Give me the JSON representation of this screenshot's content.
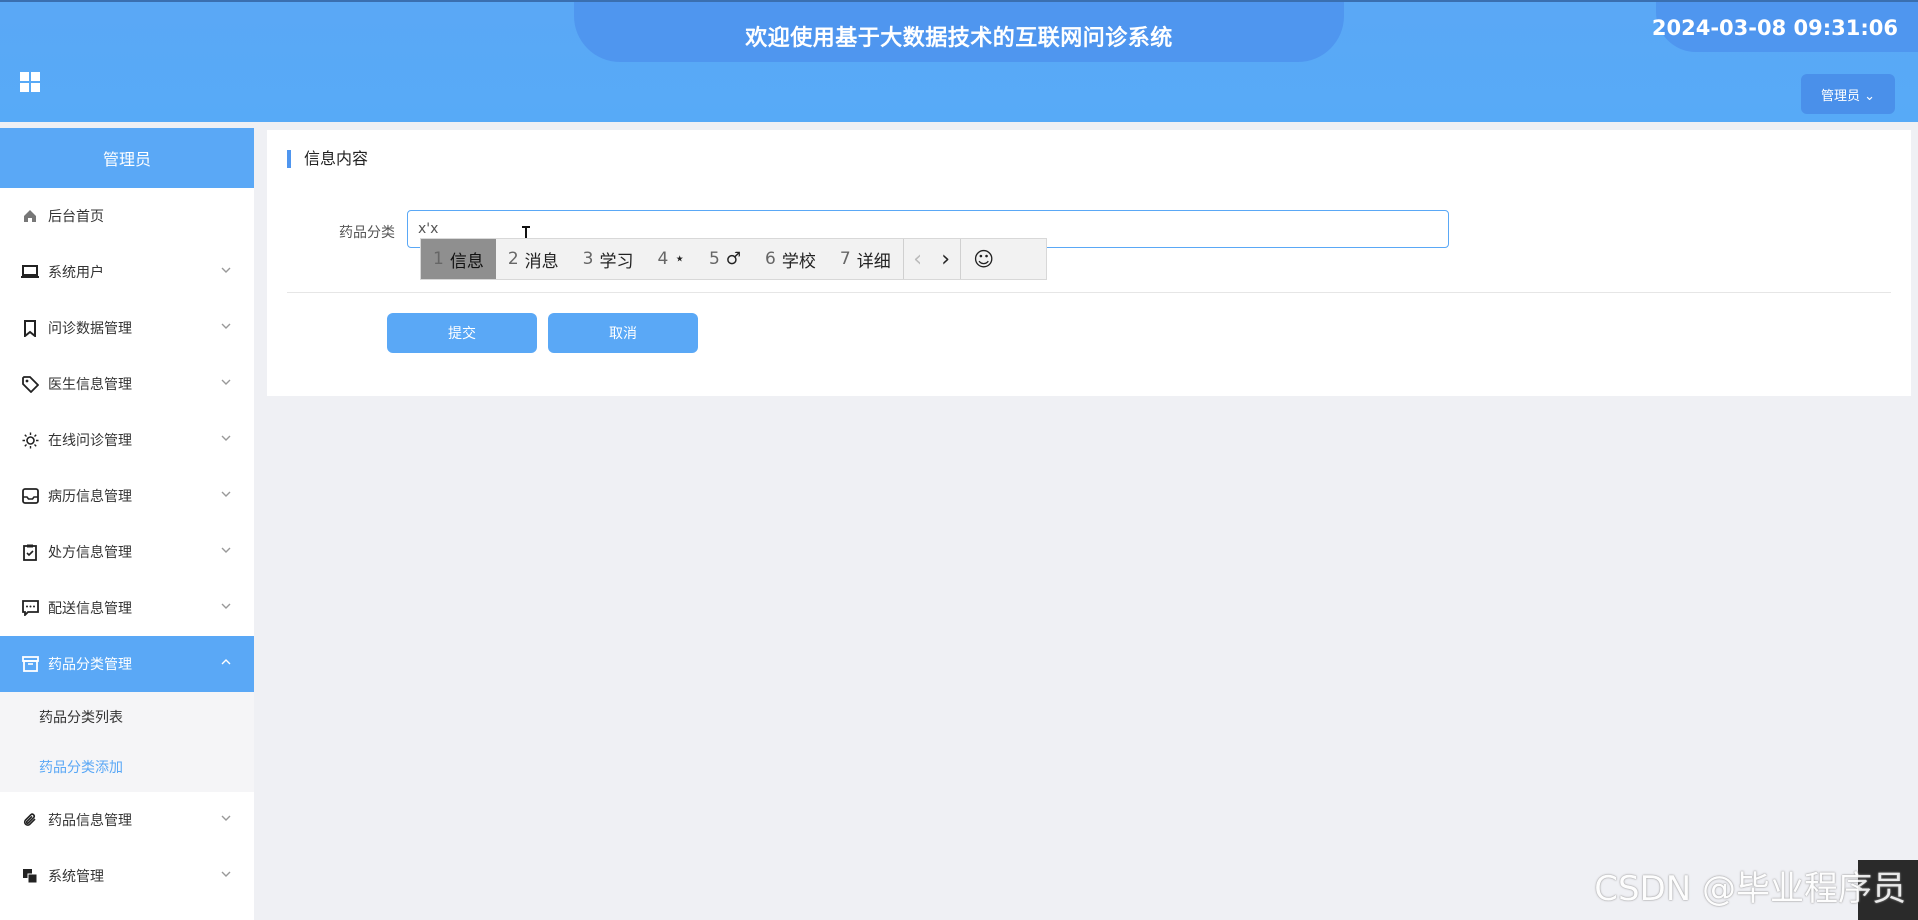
{
  "header": {
    "title": "欢迎使用基于大数据技术的互联网问诊系统",
    "datetime": "2024-03-08 09:31:06",
    "user_menu": "管理员 ⌄"
  },
  "sidebar": {
    "role": "管理员",
    "items": [
      {
        "label": "后台首页",
        "icon": "home-icon"
      },
      {
        "label": "系统用户",
        "icon": "monitor-icon"
      },
      {
        "label": "问诊数据管理",
        "icon": "bookmark-icon"
      },
      {
        "label": "医生信息管理",
        "icon": "tag-icon"
      },
      {
        "label": "在线问诊管理",
        "icon": "sun-icon"
      },
      {
        "label": "病历信息管理",
        "icon": "inbox-icon"
      },
      {
        "label": "处方信息管理",
        "icon": "clipboard-check-icon"
      },
      {
        "label": "配送信息管理",
        "icon": "chat-icon"
      },
      {
        "label": "药品分类管理",
        "icon": "archive-icon",
        "active": true
      },
      {
        "label": "药品信息管理",
        "icon": "paperclip-icon"
      },
      {
        "label": "系统管理",
        "icon": "copy-icon"
      }
    ],
    "submenu": [
      {
        "label": "药品分类列表"
      },
      {
        "label": "药品分类添加",
        "selected": true
      }
    ]
  },
  "main": {
    "section_title": "信息内容",
    "field_label": "药品分类",
    "field_value": "x'x",
    "submit_label": "提交",
    "cancel_label": "取消"
  },
  "ime": {
    "candidates": [
      {
        "num": "1",
        "text": "信息"
      },
      {
        "num": "2",
        "text": "消息"
      },
      {
        "num": "3",
        "text": "学习"
      },
      {
        "num": "4",
        "text": "⋆"
      },
      {
        "num": "5",
        "text": "♂"
      },
      {
        "num": "6",
        "text": "学校"
      },
      {
        "num": "7",
        "text": "详细"
      }
    ],
    "prev": "‹",
    "next": "›",
    "emoji": "☺"
  },
  "watermark": "CSDN @毕业程序员",
  "colors": {
    "primary": "#5aa8f6",
    "header_tab": "#4f96ef",
    "page_bg": "#eff0f4"
  }
}
